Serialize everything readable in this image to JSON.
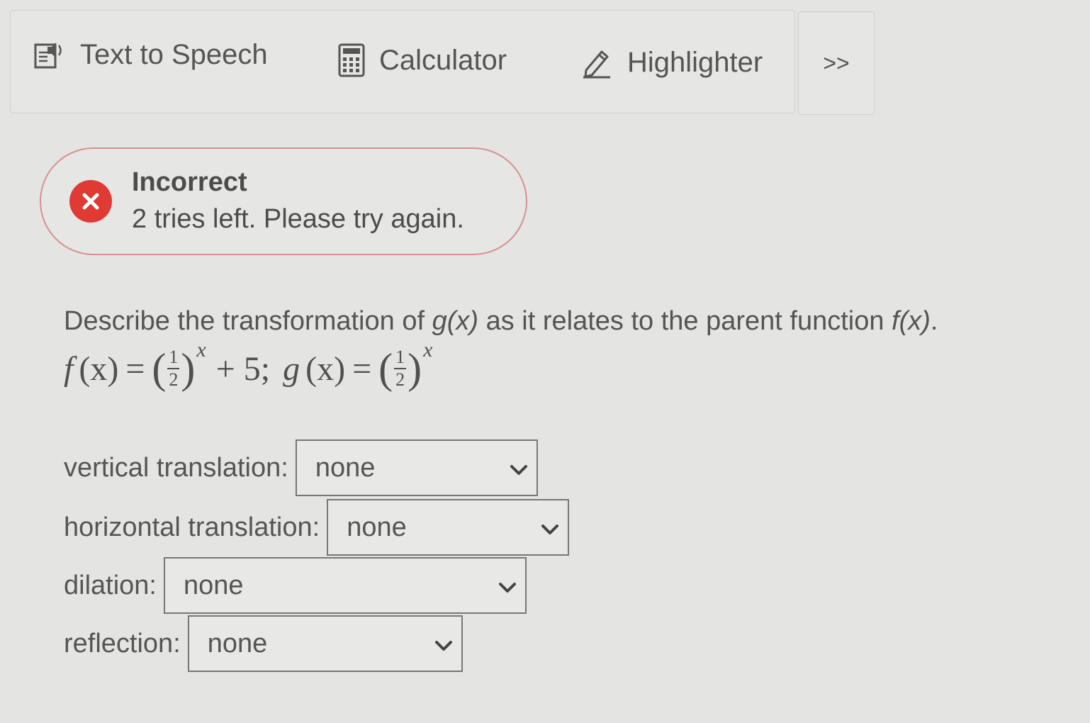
{
  "toolbar": {
    "tts_label": "Text to Speech",
    "tts_icon": "speaker-document-icon",
    "calculator_label": "Calculator",
    "calculator_icon": "calculator-icon",
    "highlighter_label": "Highlighter",
    "highlighter_icon": "pen-icon",
    "more_label": ">>"
  },
  "feedback": {
    "icon": "close-circle-icon",
    "icon_color": "#e03a35",
    "border_color": "#d88f8f",
    "title": "Incorrect",
    "message": "2 tries left. Please try again."
  },
  "question": {
    "prompt_pre": "Describe the transformation of ",
    "g_label": "g(x)",
    "prompt_mid": " as it relates to the parent function ",
    "f_label": "f(x)",
    "prompt_end": ".",
    "equation": {
      "f_name": "f",
      "g_name": "g",
      "arg": "(x)",
      "equals": "=",
      "frac_num": "1",
      "frac_den": "2",
      "exponent": "x",
      "f_rest": "+ 5;"
    }
  },
  "rows": [
    {
      "label": "vertical translation:",
      "value": "none"
    },
    {
      "label": "horizontal translation:",
      "value": "none"
    },
    {
      "label": "dilation:",
      "value": "none"
    },
    {
      "label": "reflection:",
      "value": "none"
    }
  ]
}
